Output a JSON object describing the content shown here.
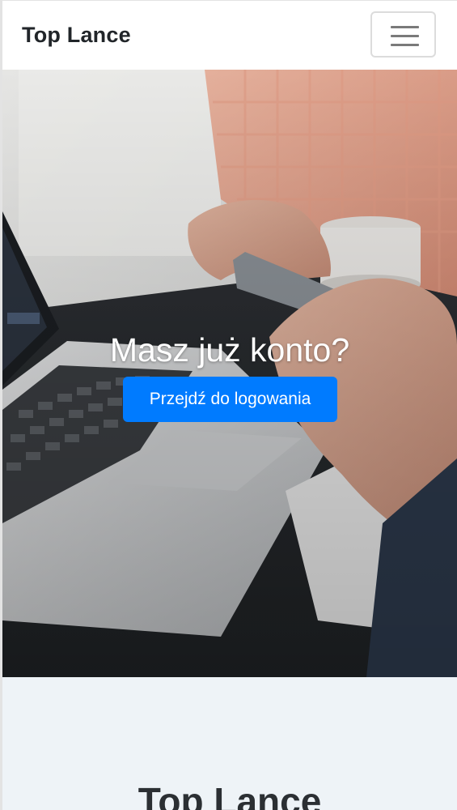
{
  "navbar": {
    "brand": "Top Lance",
    "toggler_icon": "hamburger-menu-icon"
  },
  "hero": {
    "title": "Masz już konto?",
    "button_label": "Przejdź do logowania",
    "background": "laptop-and-phone-photo"
  },
  "section": {
    "title": "Top Lance"
  },
  "colors": {
    "primary_button": "#007bff",
    "section_background": "#eef3f7",
    "brand_text": "#212529"
  }
}
